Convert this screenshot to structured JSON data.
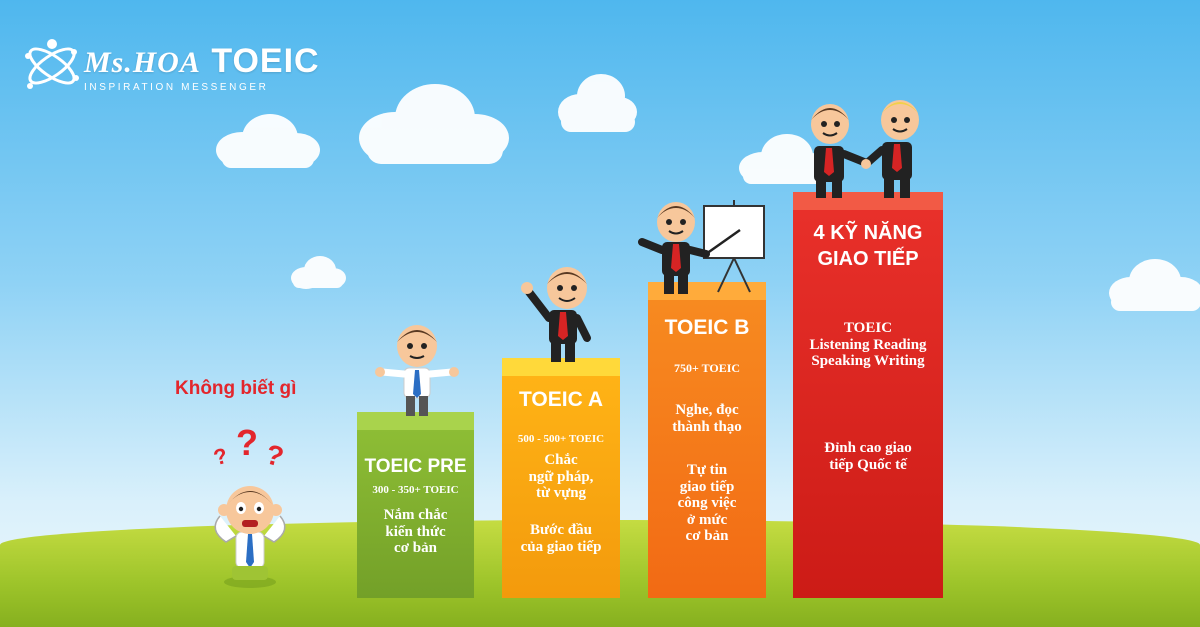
{
  "logo": {
    "title_prefix": "Ms.HOA",
    "title_suffix": "TOEIC",
    "subtitle": "INSPIRATION MESSENGER",
    "icon": "atom-person-icon"
  },
  "start": {
    "label": "Không biết gì",
    "marks": [
      "?",
      "?",
      "?"
    ]
  },
  "levels": [
    {
      "title": "TOEIC PRE",
      "score": "300 - 350+ TOEIC",
      "desc": [
        "Nắm chắc",
        "kiến thức",
        "cơ bản"
      ],
      "color": "#7fb02f"
    },
    {
      "title": "TOEIC A",
      "score": "500 - 500+ TOEIC",
      "desc": [
        "Chắc",
        "ngữ pháp,",
        "từ vựng"
      ],
      "desc2": [
        "Bước đầu",
        "của giao tiếp"
      ],
      "color": "#f5a40d"
    },
    {
      "title": "TOEIC B",
      "score": "750+ TOEIC",
      "desc": [
        "Nghe, đọc",
        "thành thạo"
      ],
      "desc2": [
        "Tự tin",
        "giao tiếp",
        "công việc",
        "ở mức",
        "cơ bản"
      ],
      "color": "#f47c1b"
    },
    {
      "title": [
        "4 KỸ NĂNG",
        "GIAO TIẾP"
      ],
      "score": [
        "TOEIC",
        "Listening Reading",
        "Speaking Writing"
      ],
      "desc": [
        "Đỉnh cao giao",
        "tiếp Quốc tế"
      ],
      "color": "#e0261f"
    }
  ]
}
